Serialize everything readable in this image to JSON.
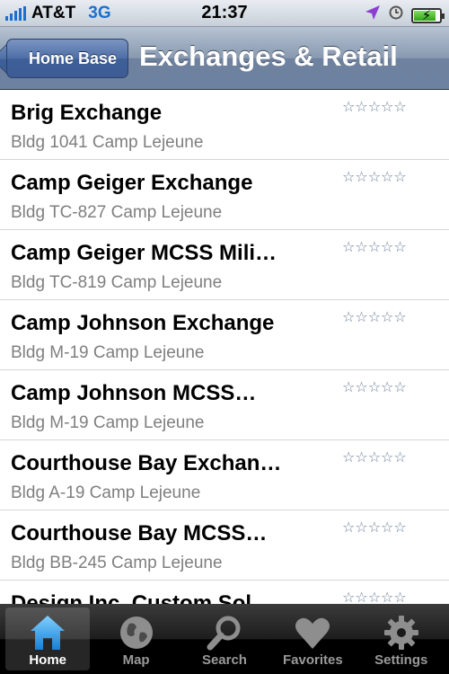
{
  "status_bar": {
    "carrier": "AT&T",
    "network": "3G",
    "time": "21:37",
    "battery_level": 0.85
  },
  "nav": {
    "back_label": "Home Base",
    "title": "Exchanges & Retail"
  },
  "rating_stars": "☆☆☆☆☆",
  "list": [
    {
      "title": "Brig Exchange",
      "subtitle": "Bldg 1041 Camp Lejeune"
    },
    {
      "title": "Camp Geiger Exchange",
      "subtitle": "Bldg TC-827 Camp Lejeune"
    },
    {
      "title": "Camp Geiger MCSS Mili…",
      "subtitle": "Bldg TC-819 Camp Lejeune"
    },
    {
      "title": "Camp Johnson Exchange",
      "subtitle": "Bldg M-19 Camp Lejeune"
    },
    {
      "title": "Camp Johnson MCSS…",
      "subtitle": "Bldg M-19 Camp Lejeune"
    },
    {
      "title": "Courthouse Bay Exchan…",
      "subtitle": "Bldg A-19 Camp Lejeune"
    },
    {
      "title": "Courthouse Bay MCSS…",
      "subtitle": "Bldg BB-245 Camp Lejeune"
    },
    {
      "title": "Design Inc. Custom Sol…",
      "subtitle": ""
    }
  ],
  "tabs": [
    {
      "label": "Home",
      "icon": "home-icon",
      "active": true
    },
    {
      "label": "Map",
      "icon": "globe-icon",
      "active": false
    },
    {
      "label": "Search",
      "icon": "search-icon",
      "active": false
    },
    {
      "label": "Favorites",
      "icon": "heart-icon",
      "active": false
    },
    {
      "label": "Settings",
      "icon": "gear-icon",
      "active": false
    }
  ],
  "colors": {
    "nav_bar": "#7d8fa9",
    "back_button": "#4a68a0",
    "accent_blue": "#1b6fcf",
    "subtitle_gray": "#7f7f7f"
  }
}
